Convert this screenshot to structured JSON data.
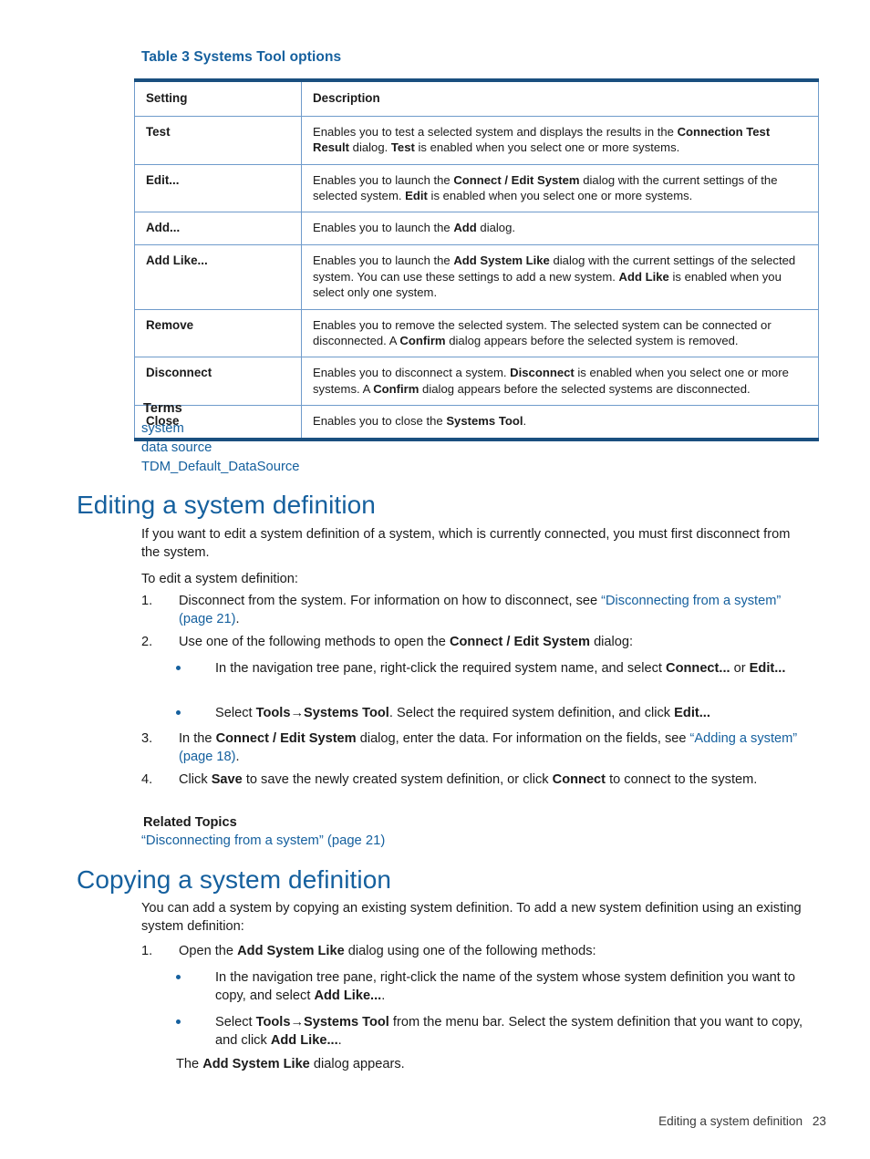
{
  "colors": {
    "heading_blue": "#15609e",
    "table_rule_dark": "#1a4f7f",
    "table_rule_light": "#6f9bcb",
    "body_text": "#1a1a1a"
  },
  "table": {
    "caption": "Table 3 Systems Tool options",
    "headers": [
      "Setting",
      "Description"
    ],
    "rows": [
      {
        "setting": "Test",
        "description_html": "Enables you to test a selected system and displays the results in the <b class=\"bd\">Connection Test Result</b> dialog. <b class=\"bd\">Test</b> is enabled when you select one or more systems."
      },
      {
        "setting": "Edit...",
        "description_html": "Enables you to launch the <b class=\"bd\">Connect / Edit System</b> dialog with the current settings of the selected system. <b class=\"bd\">Edit</b> is enabled when you select one or more systems."
      },
      {
        "setting": "Add...",
        "description_html": "Enables you to launch the <b class=\"bd\">Add</b> dialog."
      },
      {
        "setting": "Add Like...",
        "description_html": "Enables you to launch the <b class=\"bd\">Add System Like</b> dialog with the current settings of the selected system. You can use these settings to add a new system. <b class=\"bd\">Add Like</b> is enabled when you select only one system."
      },
      {
        "setting": "Remove",
        "description_html": "Enables you to remove the selected system. The selected system can be connected or disconnected. A <b class=\"bd\">Confirm</b> dialog appears before the selected system is removed."
      },
      {
        "setting": "Disconnect",
        "description_html": "Enables you to disconnect a system. <b class=\"bd\">Disconnect</b> is enabled when you select one or more systems. A <b class=\"bd\">Confirm</b> dialog appears before the selected systems are disconnected."
      },
      {
        "setting": "Close",
        "description_html": "Enables you to close the <b class=\"bd\">Systems Tool</b>."
      }
    ]
  },
  "terms": {
    "heading": "Terms",
    "links": [
      "system",
      "data source",
      "TDM_Default_DataSource"
    ]
  },
  "section_editing": {
    "heading": "Editing a system definition",
    "intro": "If you want to edit a system definition of a system, which is currently connected, you must first disconnect from the system.",
    "lead_in": "To edit a system definition:",
    "steps": [
      {
        "number": "1.",
        "html": "Disconnect from the system. For information on how to disconnect, see <span class=\"doclink\">“Disconnecting from a system” (page 21)</span>."
      },
      {
        "number": "2.",
        "html": "Use one of the following methods to open the <b class=\"bd\">Connect / Edit System</b> dialog:"
      },
      {
        "number": "3.",
        "html": "In the <b class=\"bd\">Connect / Edit System</b> dialog, enter the data. For information on the fields, see <span class=\"doclink\">“Adding a system” (page 18)</span>."
      },
      {
        "number": "4.",
        "html": "Click <b class=\"bd\">Save</b> to save the newly created system definition, or click <b class=\"bd\">Connect</b> to connect to the system."
      }
    ],
    "bullets": [
      {
        "html": "In the navigation tree pane, right-click the required system name, and select <b class=\"bd\">Connect...</b> or <b class=\"bd\">Edit...</b>"
      },
      {
        "html": "Select <b class=\"bd\">Tools→Systems Tool</b>. Select the required system definition, and click <b class=\"bd\">Edit...</b>"
      }
    ],
    "related_heading": "Related Topics",
    "related_link": "“Disconnecting from a system” (page 21)"
  },
  "section_copying": {
    "heading": "Copying a system definition",
    "intro": "You can add a system by copying an existing system definition. To add a new system definition using an existing system definition:",
    "steps": [
      {
        "number": "1.",
        "html": "Open the <b class=\"bd\">Add System Like</b> dialog using one of the following methods:"
      }
    ],
    "bullets": [
      {
        "html": "In the navigation tree pane, right-click the name of the system whose system definition you want to copy, and select <b class=\"bd\">Add Like...</b>."
      },
      {
        "html": "Select <b class=\"bd\">Tools→Systems Tool</b> from the menu bar. Select the system definition that you want to copy, and click <b class=\"bd\">Add Like...</b>."
      }
    ],
    "closing_html": "The <b class=\"bd\">Add System Like</b> dialog appears."
  },
  "footer": {
    "title": "Editing a system definition",
    "page_number": "23"
  }
}
